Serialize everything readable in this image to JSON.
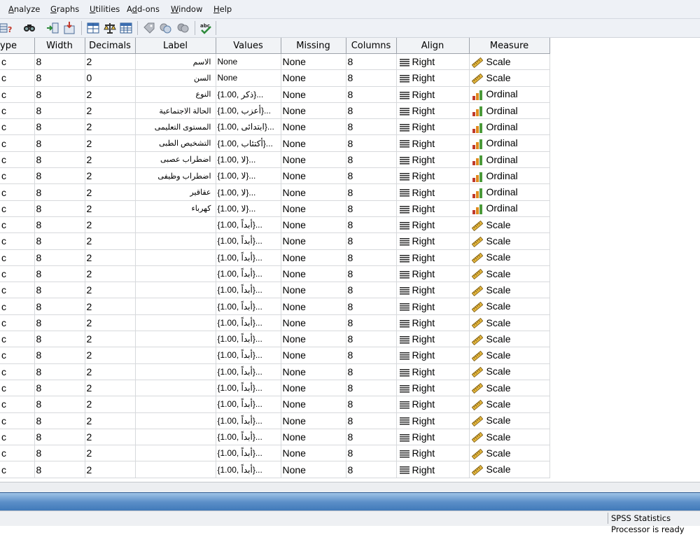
{
  "menu": [
    "Analyze",
    "Graphs",
    "Utilities",
    "Add-ons",
    "Window",
    "Help"
  ],
  "menu_underline": [
    "A",
    "G",
    "U",
    "d",
    "W",
    "H"
  ],
  "toolbar_icons": [
    "variables-icon",
    "find-icon",
    "insert-variable-icon",
    "insert-case-icon",
    "split-file-icon",
    "weight-cases-icon",
    "select-cases-icon",
    "value-labels-icon",
    "use-sets-icon",
    "show-all-icon",
    "spell-check-icon"
  ],
  "columns": [
    "ype",
    "Width",
    "Decimals",
    "Label",
    "Values",
    "Missing",
    "Columns",
    "Align",
    "Measure"
  ],
  "rows": [
    {
      "type": "c",
      "width": "8",
      "decimals": "2",
      "label": "الاسم",
      "values": "None",
      "missing": "None",
      "columns": "8",
      "align": "Right",
      "measure": "Scale"
    },
    {
      "type": "c",
      "width": "8",
      "decimals": "0",
      "label": "السن",
      "values": "None",
      "missing": "None",
      "columns": "8",
      "align": "Right",
      "measure": "Scale"
    },
    {
      "type": "c",
      "width": "8",
      "decimals": "2",
      "label": "النوع",
      "values": "{1.00, ذكر}...",
      "missing": "None",
      "columns": "8",
      "align": "Right",
      "measure": "Ordinal"
    },
    {
      "type": "c",
      "width": "8",
      "decimals": "2",
      "label": "الحالة الاجتماعية",
      "values": "{1.00, أعزب}...",
      "missing": "None",
      "columns": "8",
      "align": "Right",
      "measure": "Ordinal"
    },
    {
      "type": "c",
      "width": "8",
      "decimals": "2",
      "label": "المستوى التعليمى",
      "values": "{1.00, ابتدائى}...",
      "missing": "None",
      "columns": "8",
      "align": "Right",
      "measure": "Ordinal"
    },
    {
      "type": "c",
      "width": "8",
      "decimals": "2",
      "label": "التشخيص الطبى",
      "values": "{1.00, أكتئاب}...",
      "missing": "None",
      "columns": "8",
      "align": "Right",
      "measure": "Ordinal"
    },
    {
      "type": "c",
      "width": "8",
      "decimals": "2",
      "label": "اضطراب عصبى",
      "values": "{1.00, لا}...",
      "missing": "None",
      "columns": "8",
      "align": "Right",
      "measure": "Ordinal"
    },
    {
      "type": "c",
      "width": "8",
      "decimals": "2",
      "label": "اضطراب وظيفى",
      "values": "{1.00, لا}...",
      "missing": "None",
      "columns": "8",
      "align": "Right",
      "measure": "Ordinal"
    },
    {
      "type": "c",
      "width": "8",
      "decimals": "2",
      "label": "عقاقير",
      "values": "{1.00, لا}...",
      "missing": "None",
      "columns": "8",
      "align": "Right",
      "measure": "Ordinal"
    },
    {
      "type": "c",
      "width": "8",
      "decimals": "2",
      "label": "كهرباء",
      "values": "{1.00, لا}...",
      "missing": "None",
      "columns": "8",
      "align": "Right",
      "measure": "Ordinal"
    },
    {
      "type": "c",
      "width": "8",
      "decimals": "2",
      "label": "",
      "values": "{1.00, أبداً}...",
      "missing": "None",
      "columns": "8",
      "align": "Right",
      "measure": "Scale"
    },
    {
      "type": "c",
      "width": "8",
      "decimals": "2",
      "label": "",
      "values": "{1.00, أبداً}...",
      "missing": "None",
      "columns": "8",
      "align": "Right",
      "measure": "Scale"
    },
    {
      "type": "c",
      "width": "8",
      "decimals": "2",
      "label": "",
      "values": "{1.00, أبداً}...",
      "missing": "None",
      "columns": "8",
      "align": "Right",
      "measure": "Scale"
    },
    {
      "type": "c",
      "width": "8",
      "decimals": "2",
      "label": "",
      "values": "{1.00, أبداً}...",
      "missing": "None",
      "columns": "8",
      "align": "Right",
      "measure": "Scale"
    },
    {
      "type": "c",
      "width": "8",
      "decimals": "2",
      "label": "",
      "values": "{1.00, أبداً}...",
      "missing": "None",
      "columns": "8",
      "align": "Right",
      "measure": "Scale"
    },
    {
      "type": "c",
      "width": "8",
      "decimals": "2",
      "label": "",
      "values": "{1.00, أبداً}...",
      "missing": "None",
      "columns": "8",
      "align": "Right",
      "measure": "Scale"
    },
    {
      "type": "c",
      "width": "8",
      "decimals": "2",
      "label": "",
      "values": "{1.00, أبداً}...",
      "missing": "None",
      "columns": "8",
      "align": "Right",
      "measure": "Scale"
    },
    {
      "type": "c",
      "width": "8",
      "decimals": "2",
      "label": "",
      "values": "{1.00, أبداً}...",
      "missing": "None",
      "columns": "8",
      "align": "Right",
      "measure": "Scale"
    },
    {
      "type": "c",
      "width": "8",
      "decimals": "2",
      "label": "",
      "values": "{1.00, أبداً}...",
      "missing": "None",
      "columns": "8",
      "align": "Right",
      "measure": "Scale"
    },
    {
      "type": "c",
      "width": "8",
      "decimals": "2",
      "label": "",
      "values": "{1.00, أبداً}...",
      "missing": "None",
      "columns": "8",
      "align": "Right",
      "measure": "Scale"
    },
    {
      "type": "c",
      "width": "8",
      "decimals": "2",
      "label": "",
      "values": "{1.00, أبداً}...",
      "missing": "None",
      "columns": "8",
      "align": "Right",
      "measure": "Scale"
    },
    {
      "type": "c",
      "width": "8",
      "decimals": "2",
      "label": "",
      "values": "{1.00, أبداً}...",
      "missing": "None",
      "columns": "8",
      "align": "Right",
      "measure": "Scale"
    },
    {
      "type": "c",
      "width": "8",
      "decimals": "2",
      "label": "",
      "values": "{1.00, أبداً}...",
      "missing": "None",
      "columns": "8",
      "align": "Right",
      "measure": "Scale"
    },
    {
      "type": "c",
      "width": "8",
      "decimals": "2",
      "label": "",
      "values": "{1.00, أبداً}...",
      "missing": "None",
      "columns": "8",
      "align": "Right",
      "measure": "Scale"
    },
    {
      "type": "c",
      "width": "8",
      "decimals": "2",
      "label": "",
      "values": "{1.00, أبداً}...",
      "missing": "None",
      "columns": "8",
      "align": "Right",
      "measure": "Scale"
    },
    {
      "type": "c",
      "width": "8",
      "decimals": "2",
      "label": "",
      "values": "{1.00, أبداً}...",
      "missing": "None",
      "columns": "8",
      "align": "Right",
      "measure": "Scale"
    }
  ],
  "status": "SPSS Statistics  Processor is ready",
  "colors": {
    "scale_icon": "#d4a52a",
    "ordinal_bars": [
      "#c0392b",
      "#e08a1e",
      "#4a9a3a"
    ],
    "tab_bar": "#4f86c1"
  }
}
